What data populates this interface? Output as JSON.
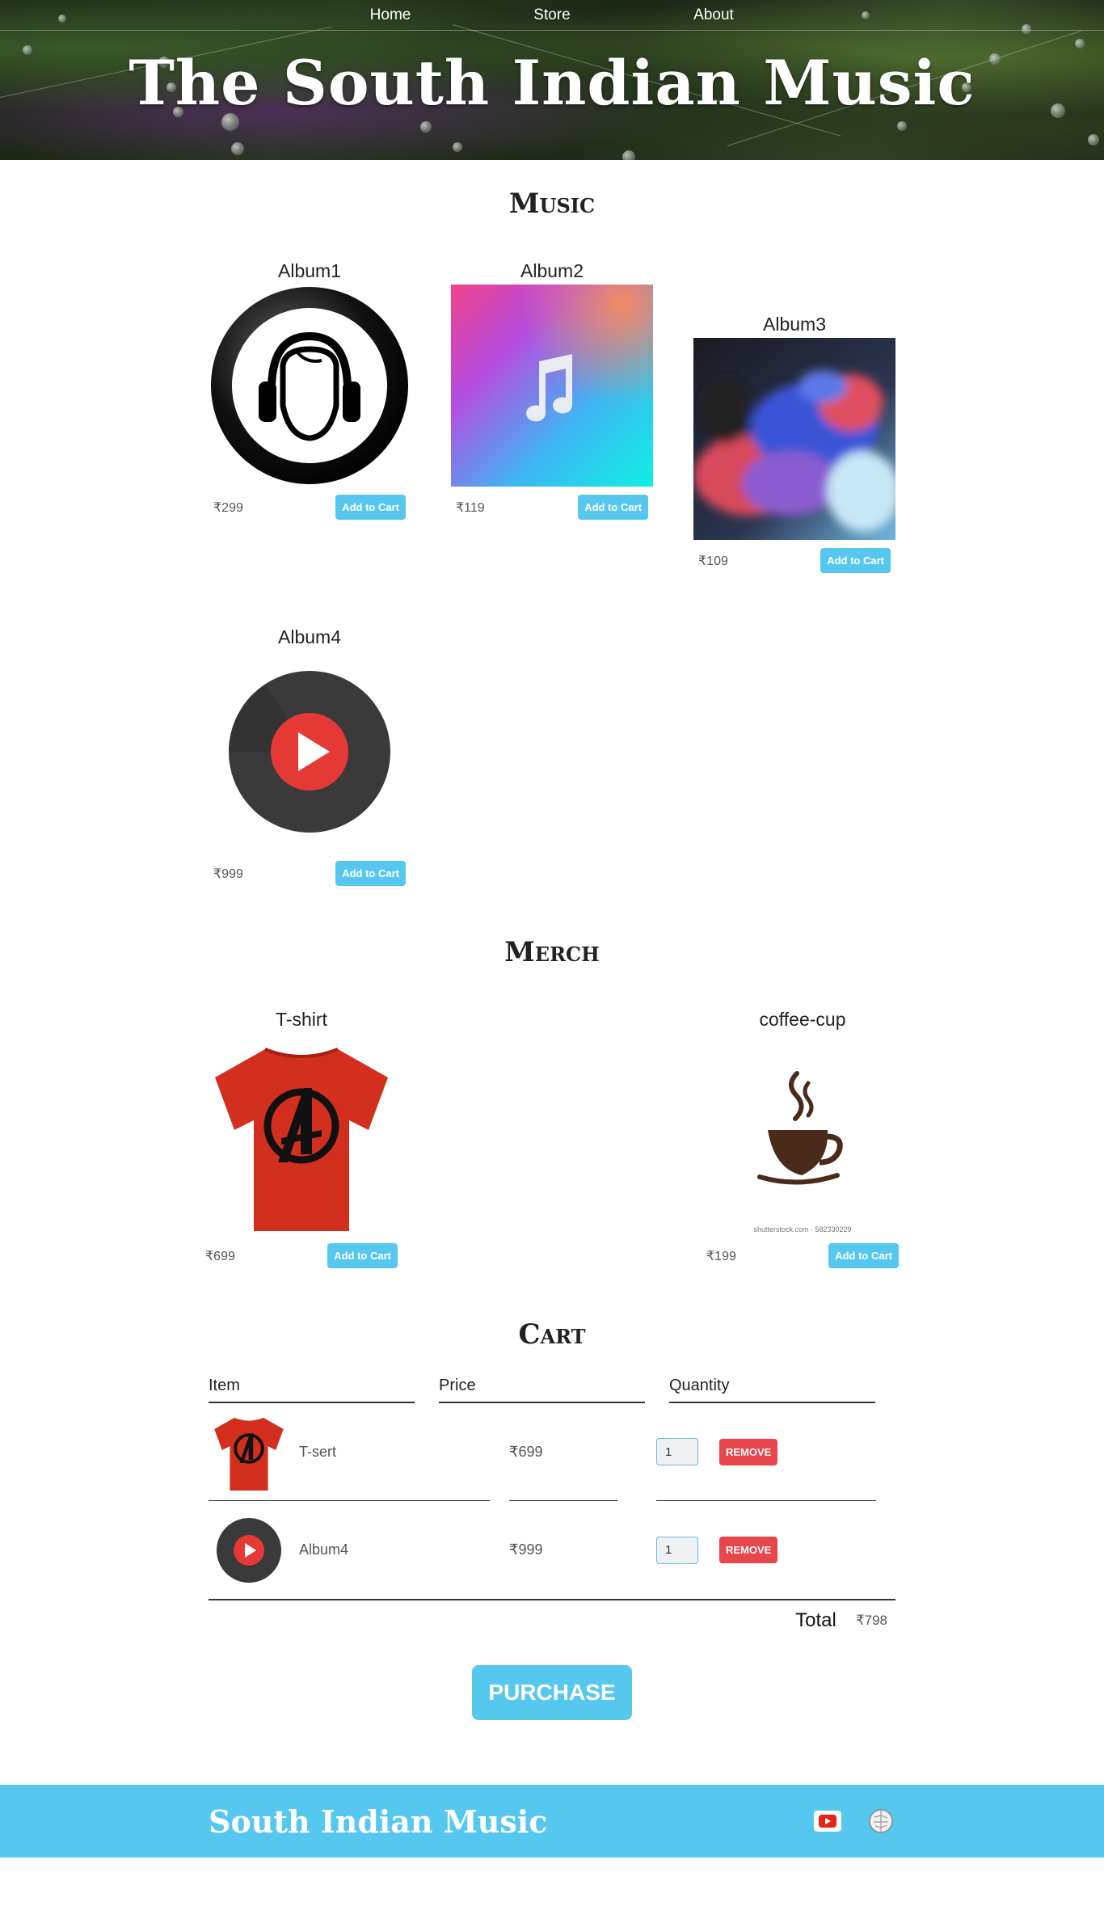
{
  "nav": {
    "home": "Home",
    "store": "Store",
    "about": "About"
  },
  "header": {
    "title": "The South Indian Music"
  },
  "music": {
    "title": "Music",
    "items": [
      {
        "title": "Album1",
        "price": "₹299",
        "button": "Add to Cart",
        "image": "headphones-icon"
      },
      {
        "title": "Album2",
        "price": "₹119",
        "button": "Add to Cart",
        "image": "music-note-icon"
      },
      {
        "title": "Album3",
        "price": "₹109",
        "button": "Add to Cart",
        "image": "color-smoke"
      },
      {
        "title": "Album4",
        "price": "₹999",
        "button": "Add to Cart",
        "image": "play-disc-icon"
      }
    ]
  },
  "merch": {
    "title": "Merch",
    "items": [
      {
        "title": "T-shirt",
        "price": "₹699",
        "button": "Add to Cart",
        "image": "avengers-tshirt"
      },
      {
        "title": "coffee-cup",
        "price": "₹199",
        "button": "Add to Cart",
        "image": "coffee-cup-icon",
        "watermark": "shutterstock.com · 582330229"
      }
    ]
  },
  "cart": {
    "title": "Cart",
    "headers": {
      "item": "Item",
      "price": "Price",
      "quantity": "Quantity"
    },
    "rows": [
      {
        "name": "T-sert",
        "price": "₹699",
        "quantity": "1",
        "remove": "REMOVE"
      },
      {
        "name": "Album4",
        "price": "₹999",
        "quantity": "1",
        "remove": "REMOVE"
      }
    ],
    "total_label": "Total",
    "total_value": "₹798",
    "purchase": "PURCHASE"
  },
  "footer": {
    "title": "South Indian Music",
    "icons": [
      "youtube-icon",
      "wikipedia-icon"
    ]
  },
  "colors": {
    "accent": "#56c8f0",
    "remove": "#e8454d"
  }
}
